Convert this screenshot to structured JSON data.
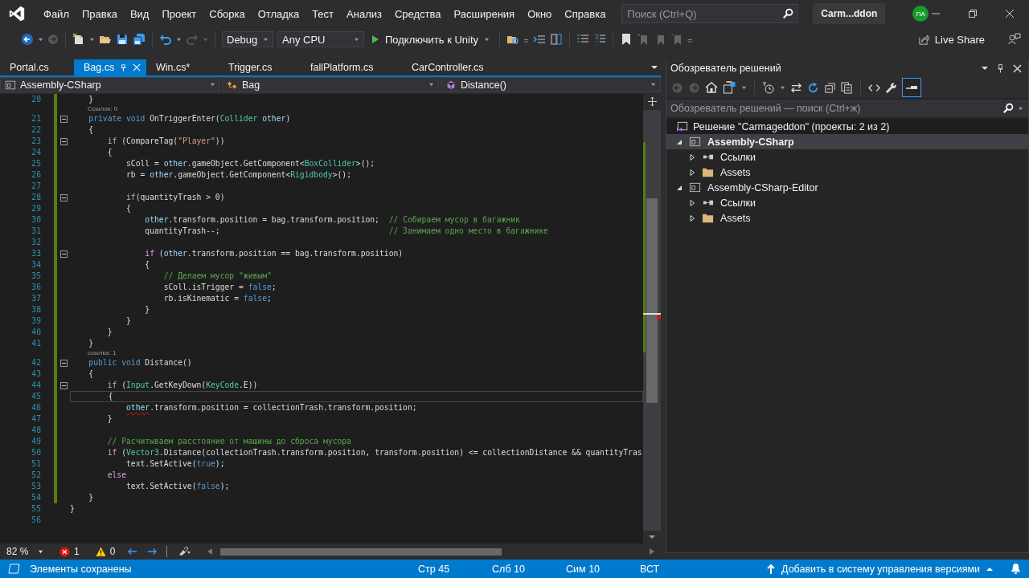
{
  "menu": {
    "items": [
      "Файл",
      "Правка",
      "Вид",
      "Проект",
      "Сборка",
      "Отладка",
      "Тест",
      "Анализ",
      "Средства",
      "Расширения",
      "Окно",
      "Справка"
    ]
  },
  "search": {
    "placeholder": "Поиск (Ctrl+Q)"
  },
  "solution_name": "Carm...ddon",
  "user_initials": "ПА",
  "toolbar": {
    "configuration": "Debug",
    "platform": "Any CPU",
    "run_label": "Подключить к Unity",
    "live_share": "Live Share"
  },
  "tabs": [
    {
      "label": "Portal.cs",
      "selected": false,
      "pinned": false
    },
    {
      "label": "Bag.cs",
      "selected": true,
      "pinned": true
    },
    {
      "label": "Win.cs*",
      "selected": false,
      "pinned": false
    },
    {
      "label": "Trigger.cs",
      "selected": false,
      "pinned": false
    },
    {
      "label": "fallPlatform.cs",
      "selected": false,
      "pinned": false
    },
    {
      "label": "CarController.cs",
      "selected": false,
      "pinned": false
    }
  ],
  "nav": {
    "project": "Assembly-CSharp",
    "class": "Bag",
    "member": "Distance()"
  },
  "code": [
    {
      "number": "20",
      "modified": true,
      "fold": false,
      "current": false,
      "tokens": [
        {
          "kind": "plain",
          "text": "    }"
        }
      ]
    },
    {
      "number": "21",
      "modified": true,
      "fold": true,
      "current": false,
      "lens": "Ссылок: 0",
      "tokens": [
        {
          "kind": "keyword",
          "text": "    private void"
        },
        {
          "kind": "plain",
          "text": " OnTriggerEnter("
        },
        {
          "kind": "type",
          "text": "Collider"
        },
        {
          "kind": "param",
          "text": " other"
        },
        {
          "kind": "plain",
          "text": ")"
        }
      ]
    },
    {
      "number": "22",
      "modified": true,
      "fold": false,
      "current": false,
      "tokens": [
        {
          "kind": "plain",
          "text": "    {"
        }
      ]
    },
    {
      "number": "23",
      "modified": true,
      "fold": true,
      "current": false,
      "tokens": [
        {
          "kind": "control",
          "text": "        if"
        },
        {
          "kind": "plain",
          "text": " (CompareTag("
        },
        {
          "kind": "string",
          "text": "\"Player\""
        },
        {
          "kind": "plain",
          "text": "))"
        }
      ]
    },
    {
      "number": "24",
      "modified": true,
      "fold": false,
      "current": false,
      "tokens": [
        {
          "kind": "plain",
          "text": "        {"
        }
      ]
    },
    {
      "number": "25",
      "modified": true,
      "fold": false,
      "current": false,
      "tokens": [
        {
          "kind": "plain",
          "text": "            sColl = "
        },
        {
          "kind": "param",
          "text": "other"
        },
        {
          "kind": "plain",
          "text": ".gameObject.GetComponent<"
        },
        {
          "kind": "type",
          "text": "BoxCollider"
        },
        {
          "kind": "plain",
          "text": ">();"
        }
      ]
    },
    {
      "number": "26",
      "modified": true,
      "fold": false,
      "current": false,
      "tokens": [
        {
          "kind": "plain",
          "text": "            rb = "
        },
        {
          "kind": "param",
          "text": "other"
        },
        {
          "kind": "plain",
          "text": ".gameObject.GetComponent<"
        },
        {
          "kind": "type",
          "text": "Rigidbody"
        },
        {
          "kind": "plain",
          "text": ">();"
        }
      ]
    },
    {
      "number": "27",
      "modified": true,
      "fold": false,
      "current": false
    },
    {
      "number": "28",
      "modified": true,
      "fold": true,
      "current": false,
      "tokens": [
        {
          "kind": "control",
          "text": "            if"
        },
        {
          "kind": "plain",
          "text": "(quantityTrash > 0)"
        }
      ]
    },
    {
      "number": "29",
      "modified": true,
      "fold": false,
      "current": false,
      "tokens": [
        {
          "kind": "plain",
          "text": "            {"
        }
      ]
    },
    {
      "number": "30",
      "modified": true,
      "fold": false,
      "current": false,
      "tokens": [
        {
          "kind": "param",
          "text": "                other"
        },
        {
          "kind": "plain",
          "text": ".transform.position = bag.transform.position;"
        },
        {
          "kind": "comment",
          "text": "  // Собираем мусор в багажник"
        }
      ]
    },
    {
      "number": "31",
      "modified": true,
      "fold": false,
      "current": false,
      "tokens": [
        {
          "kind": "plain",
          "text": "                quantityTrash--;"
        },
        {
          "kind": "comment",
          "text": "                                    // Занимаем одно место в багажнике"
        }
      ]
    },
    {
      "number": "32",
      "modified": true,
      "fold": false,
      "current": false
    },
    {
      "number": "33",
      "modified": true,
      "fold": true,
      "current": false,
      "tokens": [
        {
          "kind": "control",
          "text": "                if"
        },
        {
          "kind": "plain",
          "text": " ("
        },
        {
          "kind": "param",
          "text": "other"
        },
        {
          "kind": "plain",
          "text": ".transform.position == bag.transform.position)"
        }
      ]
    },
    {
      "number": "34",
      "modified": true,
      "fold": false,
      "current": false,
      "tokens": [
        {
          "kind": "plain",
          "text": "                {"
        }
      ]
    },
    {
      "number": "35",
      "modified": true,
      "fold": false,
      "current": false,
      "tokens": [
        {
          "kind": "comment",
          "text": "                    // Делаем мусор \"живым\""
        }
      ]
    },
    {
      "number": "36",
      "modified": true,
      "fold": false,
      "current": false,
      "tokens": [
        {
          "kind": "plain",
          "text": "                    sColl.isTrigger = "
        },
        {
          "kind": "keyword",
          "text": "false"
        },
        {
          "kind": "plain",
          "text": ";"
        }
      ]
    },
    {
      "number": "37",
      "modified": true,
      "fold": false,
      "current": false,
      "tokens": [
        {
          "kind": "plain",
          "text": "                    rb.isKinematic = "
        },
        {
          "kind": "keyword",
          "text": "false"
        },
        {
          "kind": "plain",
          "text": ";"
        }
      ]
    },
    {
      "number": "38",
      "modified": true,
      "fold": false,
      "current": false,
      "tokens": [
        {
          "kind": "plain",
          "text": "                }"
        }
      ]
    },
    {
      "number": "39",
      "modified": true,
      "fold": false,
      "current": false,
      "tokens": [
        {
          "kind": "plain",
          "text": "            }"
        }
      ]
    },
    {
      "number": "40",
      "modified": true,
      "fold": false,
      "current": false,
      "tokens": [
        {
          "kind": "plain",
          "text": "        }"
        }
      ]
    },
    {
      "number": "41",
      "modified": true,
      "fold": false,
      "current": false,
      "tokens": [
        {
          "kind": "plain",
          "text": "    }"
        }
      ]
    },
    {
      "number": "42",
      "modified": true,
      "fold": true,
      "current": false,
      "lens": "ссылка: 1",
      "tokens": [
        {
          "kind": "keyword",
          "text": "    public void"
        },
        {
          "kind": "plain",
          "text": " Distance()"
        }
      ]
    },
    {
      "number": "43",
      "modified": true,
      "fold": false,
      "current": false,
      "tokens": [
        {
          "kind": "plain",
          "text": "    {"
        }
      ]
    },
    {
      "number": "44",
      "modified": true,
      "fold": true,
      "current": false,
      "tokens": [
        {
          "kind": "control",
          "text": "        if"
        },
        {
          "kind": "plain",
          "text": " ("
        },
        {
          "kind": "type",
          "text": "Input"
        },
        {
          "kind": "plain",
          "text": ".GetKeyDown("
        },
        {
          "kind": "type",
          "text": "KeyCode"
        },
        {
          "kind": "plain",
          "text": ".E))"
        }
      ]
    },
    {
      "number": "45",
      "modified": true,
      "fold": false,
      "current": true,
      "tokens": [
        {
          "kind": "plain",
          "text": "        {"
        }
      ]
    },
    {
      "number": "46",
      "modified": true,
      "fold": false,
      "current": false,
      "tokens": [
        {
          "kind": "error",
          "text": "            other"
        },
        {
          "kind": "plain",
          "text": ".transform.position = collectionTrash.transform.position;"
        }
      ]
    },
    {
      "number": "47",
      "modified": true,
      "fold": false,
      "current": false,
      "tokens": [
        {
          "kind": "plain",
          "text": "        }"
        }
      ]
    },
    {
      "number": "48",
      "modified": true,
      "fold": false,
      "current": false
    },
    {
      "number": "49",
      "modified": true,
      "fold": false,
      "current": false,
      "tokens": [
        {
          "kind": "comment",
          "text": "        // Расчитываем расстояние от машины до сброса мусора"
        }
      ]
    },
    {
      "number": "50",
      "modified": true,
      "fold": false,
      "current": false,
      "tokens": [
        {
          "kind": "control",
          "text": "        if"
        },
        {
          "kind": "plain",
          "text": " ("
        },
        {
          "kind": "type",
          "text": "Vector3"
        },
        {
          "kind": "plain",
          "text": ".Distance(collectionTrash.transform.position, transform.position) <= collectionDistance && quantityTras"
        }
      ]
    },
    {
      "number": "51",
      "modified": true,
      "fold": false,
      "current": false,
      "tokens": [
        {
          "kind": "plain",
          "text": "            text.SetActive("
        },
        {
          "kind": "keyword",
          "text": "true"
        },
        {
          "kind": "plain",
          "text": ");"
        }
      ]
    },
    {
      "number": "52",
      "modified": true,
      "fold": false,
      "current": false,
      "tokens": [
        {
          "kind": "control",
          "text": "        else"
        }
      ]
    },
    {
      "number": "53",
      "modified": true,
      "fold": false,
      "current": false,
      "tokens": [
        {
          "kind": "plain",
          "text": "            text.SetActive("
        },
        {
          "kind": "keyword",
          "text": "false"
        },
        {
          "kind": "plain",
          "text": ");"
        }
      ]
    },
    {
      "number": "54",
      "modified": true,
      "fold": false,
      "current": false,
      "tokens": [
        {
          "kind": "plain",
          "text": "    }"
        }
      ]
    },
    {
      "number": "55",
      "modified": false,
      "fold": false,
      "current": false,
      "tokens": [
        {
          "kind": "plain",
          "text": "}"
        }
      ]
    },
    {
      "number": "56",
      "modified": false,
      "fold": false,
      "current": false
    }
  ],
  "editor_status": {
    "zoom": "82 %",
    "errors": "1",
    "warnings": "0"
  },
  "solution_explorer": {
    "title": "Обозреватель решений",
    "search_placeholder": "Обозреватель решений — поиск (Ctrl+ж)",
    "solution": {
      "label": "Решение \"Carmageddon\" (проекты: 2 из 2)"
    },
    "projects": [
      {
        "label": "Assembly-CSharp",
        "expanded": true,
        "selected": true,
        "startup": true,
        "children": [
          {
            "kind": "references",
            "label": "Ссылки",
            "expanded": false
          },
          {
            "kind": "folder",
            "label": "Assets",
            "expanded": false
          }
        ]
      },
      {
        "label": "Assembly-CSharp-Editor",
        "expanded": true,
        "selected": false,
        "startup": false,
        "children": [
          {
            "kind": "references",
            "label": "Ссылки",
            "expanded": false
          },
          {
            "kind": "folder",
            "label": "Assets",
            "expanded": false
          }
        ]
      }
    ]
  },
  "status_bar": {
    "message": "Элементы сохранены",
    "line": "Стр 45",
    "column": "Слб 10",
    "char": "Сим 10",
    "mode": "ВСТ",
    "source_control": "Добавить в систему управления версиями"
  }
}
